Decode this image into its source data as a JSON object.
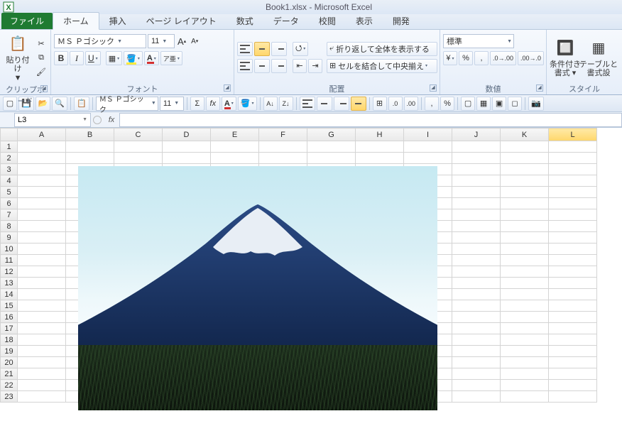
{
  "title": "Book1.xlsx - Microsoft Excel",
  "tabs": {
    "file": "ファイル",
    "home": "ホーム",
    "insert": "挿入",
    "pagelayout": "ページ レイアウト",
    "formulas": "数式",
    "data": "データ",
    "review": "校閲",
    "view": "表示",
    "developer": "開発"
  },
  "clipboard": {
    "paste": "貼り付け",
    "group": "クリップボード"
  },
  "font": {
    "name": "ＭＳ Ｐゴシック",
    "size": "11",
    "sizeup": "A",
    "sizedn": "A",
    "bold": "B",
    "italic": "I",
    "underline": "U",
    "ruby": "ア亜",
    "group": "フォント"
  },
  "alignment": {
    "wrap": "折り返して全体を表示する",
    "merge": "セルを結合して中央揃え",
    "group": "配置"
  },
  "number": {
    "format": "標準",
    "group": "数値",
    "currency": "",
    "percent": "%",
    "comma": ",",
    "inc": ".0₀",
    "dec": "₀.0"
  },
  "styles": {
    "cond": "条件付き\n書式 ▾",
    "table": "テーブルと\n書式設",
    "group": "スタイル"
  },
  "qat_font": {
    "name": "ＭＳ Ｐゴシック",
    "size": "11"
  },
  "namebox": "L3",
  "fx": "fx",
  "columns": [
    "A",
    "B",
    "C",
    "D",
    "E",
    "F",
    "G",
    "H",
    "I",
    "J",
    "K",
    "L"
  ],
  "rows": [
    "1",
    "2",
    "3",
    "4",
    "5",
    "6",
    "7",
    "8",
    "9",
    "10",
    "11",
    "12",
    "13",
    "14",
    "15",
    "16",
    "17",
    "18",
    "19",
    "20",
    "21",
    "22",
    "23"
  ],
  "selected_col": "L",
  "glyph": {
    "yen": "¥",
    "pct": "%",
    "comma": ",",
    "sigma": "Σ",
    "fx": "fx",
    "sortaz": "A↓Z",
    "sortza": "Z↓A"
  }
}
